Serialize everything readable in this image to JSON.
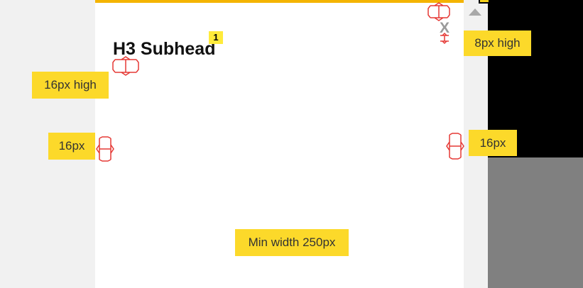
{
  "heading": {
    "text": "H3 Subhead",
    "badge": "1"
  },
  "close_icon": {
    "glyph": "X"
  },
  "annotations": {
    "top_spacing": "8px high",
    "heading_spacing": "16px high",
    "left_padding": "16px",
    "right_padding": "16px",
    "min_width": "Min width 250px"
  },
  "colors": {
    "accent_bar": "#f4b400",
    "label_bg": "#fcd92a",
    "marker": "#e53935",
    "badge_bg": "#ffeb3b"
  }
}
